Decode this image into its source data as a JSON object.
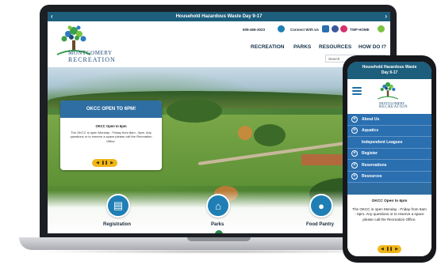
{
  "laptop": {
    "banner": {
      "text": "Household Hazardous Waste Day 9-17",
      "prev_icon": "chevron-left-icon",
      "next_icon": "chevron-right-icon"
    },
    "logo": {
      "line1": "MONTGOMERY",
      "line2": "RECREATION"
    },
    "utility": {
      "phone": "609-466-3023",
      "connect": "Connect With Us",
      "twp": "TWP HOME"
    },
    "nav": [
      "RECREATION",
      "PARKS",
      "RESOURCES",
      "HOW DO I?"
    ],
    "search": {
      "placeholder": "Search"
    },
    "popup": {
      "title": "OKCC OPEN TO 6PM!",
      "subtitle": "OKCC Open to 6pm",
      "body": "The OKCC is open Monday - Friday from 8am - 6pm. Any questions or to reserve a space please call the Recreation Office."
    },
    "quick_links": [
      {
        "label": "Registration",
        "icon": "clipboard-icon"
      },
      {
        "label": "Parks",
        "icon": "playground-icon"
      },
      {
        "label": "Food Pantry",
        "icon": "apple-icon"
      }
    ]
  },
  "phone": {
    "banner": {
      "line1": "Household Hazardous Waste",
      "line2": "Day 9-17"
    },
    "logo": {
      "line1": "MONTGOMERY",
      "line2": "RECREATION"
    },
    "menu": [
      {
        "label": "About Us",
        "expandable": true
      },
      {
        "label": "Aquatics",
        "expandable": true
      },
      {
        "label": "Independent Leagues",
        "expandable": false
      },
      {
        "label": "Register",
        "expandable": true
      },
      {
        "label": "Reservations",
        "expandable": true
      },
      {
        "label": "Resources",
        "expandable": true
      }
    ],
    "card": {
      "title": "OKCC Open to 6pm",
      "body": "The OKCC is open Monday - Friday from 8am - 6pm. Any questions or to reserve a space please call the Recreation Office."
    }
  },
  "colors": {
    "brand_blue": "#1c5e7c",
    "menu_blue": "#2a6fb0",
    "accent_yellow": "#f0b619",
    "icon_blue": "#1f7fb5"
  }
}
